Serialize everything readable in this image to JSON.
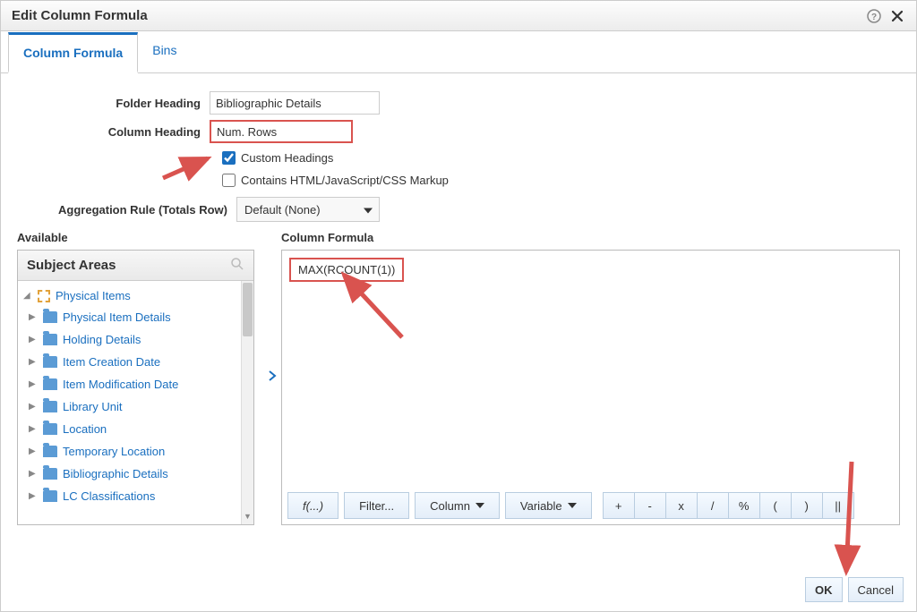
{
  "dialog": {
    "title": "Edit Column Formula"
  },
  "tabs": [
    {
      "label": "Column Formula",
      "active": true
    },
    {
      "label": "Bins",
      "active": false
    }
  ],
  "form": {
    "folder_heading_label": "Folder Heading",
    "folder_heading_value": "Bibliographic Details",
    "column_heading_label": "Column Heading",
    "column_heading_value": "Num. Rows",
    "custom_headings_label": "Custom Headings",
    "custom_headings_checked": true,
    "contains_markup_label": "Contains HTML/JavaScript/CSS Markup",
    "contains_markup_checked": false,
    "aggregation_label": "Aggregation Rule (Totals Row)",
    "aggregation_value": "Default (None)"
  },
  "available": {
    "label": "Available",
    "header": "Subject Areas",
    "root": "Physical Items",
    "children": [
      "Physical Item Details",
      "Holding Details",
      "Item Creation Date",
      "Item Modification Date",
      "Library Unit",
      "Location",
      "Temporary Location",
      "Bibliographic Details",
      "LC Classifications"
    ]
  },
  "formula": {
    "label": "Column Formula",
    "text": "MAX(RCOUNT(1))"
  },
  "toolbar": {
    "fn": "f(...)",
    "filter": "Filter...",
    "column": "Column",
    "variable": "Variable",
    "ops": [
      "+",
      "-",
      "x",
      "/",
      "%",
      "(",
      ")",
      "||"
    ]
  },
  "footer": {
    "ok": "OK",
    "cancel": "Cancel"
  }
}
